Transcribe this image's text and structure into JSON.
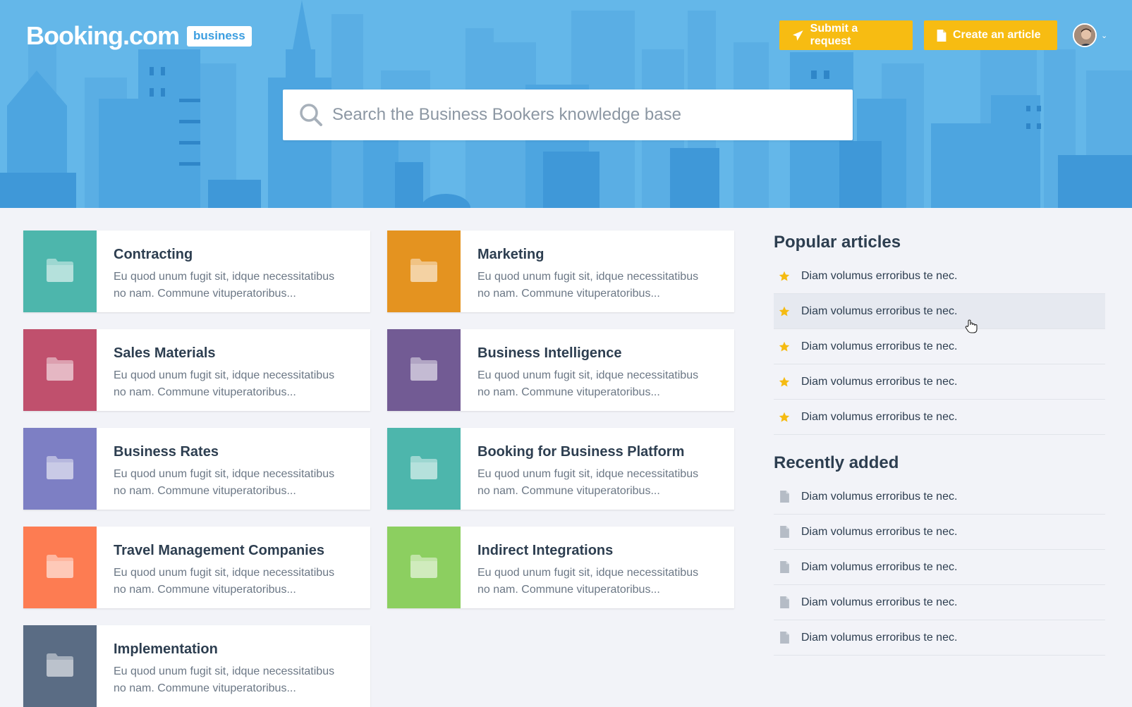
{
  "header": {
    "logo_text": "Booking.com",
    "logo_badge": "business",
    "submit_label": "Submit a request",
    "create_label": "Create an article",
    "search_placeholder": "Search the Business Bookers knowledge base"
  },
  "colors": {
    "hero_bg": "#64b7e9",
    "accent_yellow": "#f7bc12",
    "page_bg": "#f2f3f8"
  },
  "categories": [
    {
      "title": "Contracting",
      "desc": "Eu quod unum fugit sit, idque necessitatibus no nam. Commune vituperatoribus...",
      "color": "#4db6ac",
      "icon": "folder-icon"
    },
    {
      "title": "Marketing",
      "desc": "Eu quod unum fugit sit, idque necessitatibus no nam. Commune vituperatoribus...",
      "color": "#e49320",
      "icon": "folder-icon"
    },
    {
      "title": "Sales Materials",
      "desc": "Eu quod unum fugit sit, idque necessitatibus no nam. Commune vituperatoribus...",
      "color": "#c0506d",
      "icon": "folder-icon"
    },
    {
      "title": "Business Intelligence",
      "desc": "Eu quod unum fugit sit, idque necessitatibus no nam. Commune vituperatoribus...",
      "color": "#725b94",
      "icon": "folder-icon"
    },
    {
      "title": "Business Rates",
      "desc": "Eu quod unum fugit sit, idque necessitatibus no nam. Commune vituperatoribus...",
      "color": "#7d7fc4",
      "icon": "folder-icon"
    },
    {
      "title": "Booking for Business Platform",
      "desc": "Eu quod unum fugit sit, idque necessitatibus no nam. Commune vituperatoribus...",
      "color": "#4db6ac",
      "icon": "folder-icon"
    },
    {
      "title": "Travel Management Companies",
      "desc": "Eu quod unum fugit sit, idque necessitatibus no nam. Commune vituperatoribus...",
      "color": "#fd7c52",
      "icon": "folder-icon"
    },
    {
      "title": "Indirect Integrations",
      "desc": "Eu quod unum fugit sit, idque necessitatibus no nam. Commune vituperatoribus...",
      "color": "#8ccf60",
      "icon": "folder-icon"
    },
    {
      "title": "Implementation",
      "desc": "Eu quod unum fugit sit, idque necessitatibus no nam. Commune vituperatoribus...",
      "color": "#5a6c84",
      "icon": "folder-icon"
    }
  ],
  "popular": {
    "title": "Popular articles",
    "items": [
      "Diam volumus erroribus te nec.",
      "Diam volumus erroribus te nec.",
      "Diam volumus erroribus te nec.",
      "Diam volumus erroribus te nec.",
      "Diam volumus erroribus te nec."
    ]
  },
  "recent": {
    "title": "Recently added",
    "items": [
      "Diam volumus erroribus te nec.",
      "Diam volumus erroribus te nec.",
      "Diam volumus erroribus te nec.",
      "Diam volumus erroribus te nec.",
      "Diam volumus erroribus te nec."
    ]
  }
}
